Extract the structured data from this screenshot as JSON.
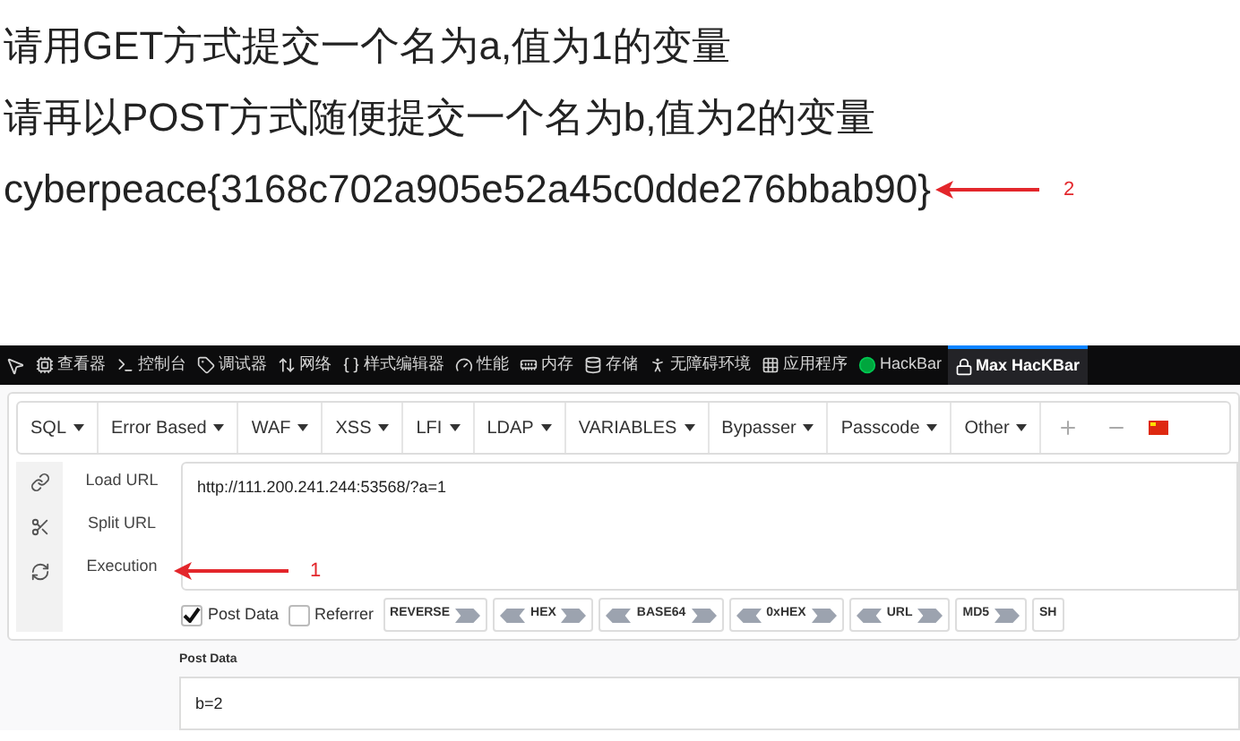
{
  "lines": [
    "请用GET方式提交一个名为a,值为1的变量",
    "请再以POST方式随便提交一个名为b,值为2的变量",
    "cyberpeace{3168c702a905e52a45c0dde276bbab90}"
  ],
  "annotation_flag": "2",
  "devtools_tabs": [
    {
      "label": "查看器",
      "selected": false
    },
    {
      "label": "控制台",
      "selected": false
    },
    {
      "label": "调试器",
      "selected": false
    },
    {
      "label": "网络",
      "selected": false
    },
    {
      "label": "样式编辑器",
      "selected": false
    },
    {
      "label": "性能",
      "selected": false
    },
    {
      "label": "内存",
      "selected": false
    },
    {
      "label": "存储",
      "selected": false
    },
    {
      "label": "无障碍环境",
      "selected": false
    },
    {
      "label": "应用程序",
      "selected": false
    },
    {
      "label": "HackBar",
      "selected": false
    },
    {
      "label": "Max HacKBar",
      "selected": true
    }
  ],
  "menu": [
    "SQL",
    "Error Based",
    "WAF",
    "XSS",
    "LFI",
    "LDAP",
    "VARIABLES",
    "Bypasser",
    "Passcode",
    "Other"
  ],
  "actions": [
    "Load URL",
    "Split URL",
    "Execution"
  ],
  "url": "http://111.200.241.244:53568/?a=1",
  "annotation_exec": "1",
  "options": [
    {
      "label": "Post Data",
      "checked": true
    },
    {
      "label": "Referrer",
      "checked": false
    }
  ],
  "encoders": [
    {
      "label": "REVERSE",
      "kind": "one_way"
    },
    {
      "label": "HEX",
      "kind": "two_way"
    },
    {
      "label": "BASE64",
      "kind": "two_way"
    },
    {
      "label": "0xHEX",
      "kind": "two_way"
    },
    {
      "label": "URL",
      "kind": "two_way"
    },
    {
      "label": "MD5",
      "kind": "one_way"
    },
    {
      "label": "SH",
      "kind": "cut"
    }
  ],
  "post_data": {
    "label": "Post Data",
    "value": "b=2"
  }
}
